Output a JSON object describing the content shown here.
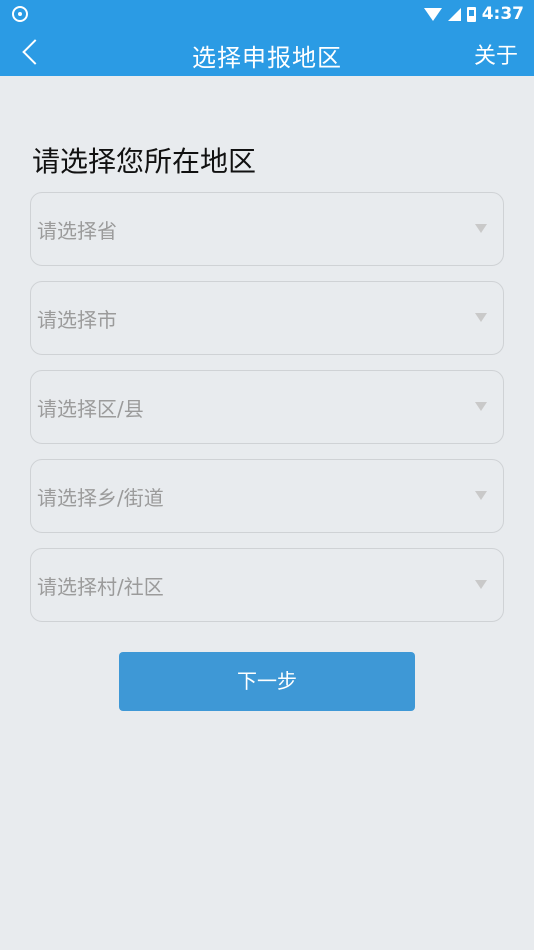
{
  "status_bar": {
    "time": "4:37"
  },
  "app_bar": {
    "title": "选择申报地区",
    "about_label": "关于"
  },
  "section_title": "请选择您所在地区",
  "selects": {
    "province": "请选择省",
    "city": "请选择市",
    "district": "请选择区/县",
    "township": "请选择乡/街道",
    "village": "请选择村/社区"
  },
  "next_label": "下一步",
  "colors": {
    "primary": "#2b9be4",
    "button": "#3e98d6",
    "background": "#e8ebee"
  }
}
